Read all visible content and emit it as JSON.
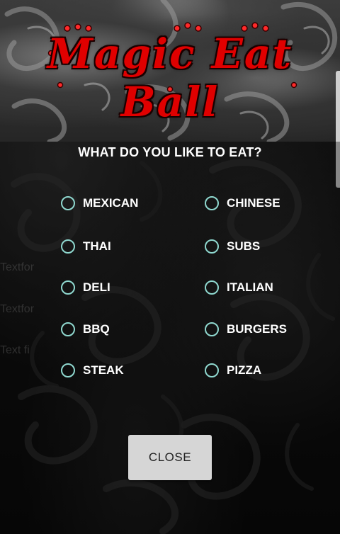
{
  "banner": {
    "title": "Magic Eat Ball"
  },
  "background_text": [
    "Textfor",
    "Textfor",
    "Text fi"
  ],
  "dialog": {
    "question": "WHAT DO YOU LIKE TO EAT?",
    "options": [
      {
        "label": "MEXICAN",
        "selected": false
      },
      {
        "label": "CHINESE",
        "selected": false
      },
      {
        "label": "THAI",
        "selected": false
      },
      {
        "label": "SUBS",
        "selected": false
      },
      {
        "label": "DELI",
        "selected": false
      },
      {
        "label": "ITALIAN",
        "selected": false
      },
      {
        "label": "BBQ",
        "selected": false
      },
      {
        "label": "BURGERS",
        "selected": false
      },
      {
        "label": "STEAK",
        "selected": false
      },
      {
        "label": "PIZZA",
        "selected": false
      }
    ],
    "close_label": "CLOSE"
  },
  "colors": {
    "title_red": "#e00000",
    "radio_outline": "#8fd8cf",
    "text": "#ffffff",
    "button_bg": "#d6d6d6"
  }
}
